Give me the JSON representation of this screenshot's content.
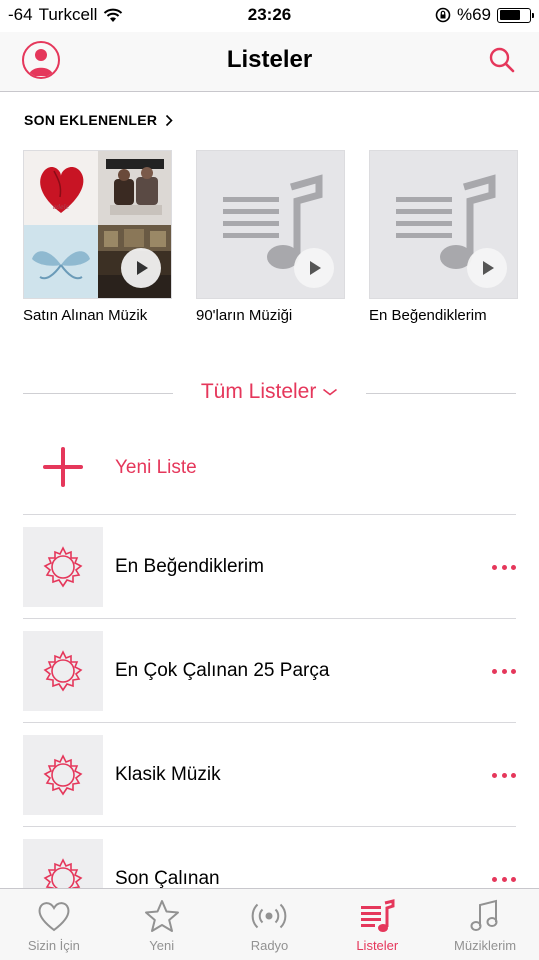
{
  "status_bar": {
    "signal": "-64",
    "carrier": "Turkcell",
    "time": "23:26",
    "battery": "%69",
    "battery_level": 0.69
  },
  "nav": {
    "title": "Listeler"
  },
  "recently_added": {
    "header": "SON EKLENENLER",
    "items": [
      {
        "label": "Satın Alınan Müzik"
      },
      {
        "label": "90'ların Müziği"
      },
      {
        "label": "En Beğendiklerim"
      }
    ]
  },
  "all_playlists": {
    "label": "Tüm Listeler"
  },
  "new_playlist": {
    "label": "Yeni Liste"
  },
  "playlists": [
    {
      "label": "En Beğendiklerim"
    },
    {
      "label": "En Çok Çalınan 25 Parça"
    },
    {
      "label": "Klasik Müzik"
    },
    {
      "label": "Son Çalınan"
    }
  ],
  "tabs": [
    {
      "label": "Sizin İçin",
      "icon": "heart-icon"
    },
    {
      "label": "Yeni",
      "icon": "star-icon"
    },
    {
      "label": "Radyo",
      "icon": "radio-icon"
    },
    {
      "label": "Listeler",
      "icon": "playlist-icon",
      "active": true
    },
    {
      "label": "Müziklerim",
      "icon": "music-note-icon"
    }
  ],
  "colors": {
    "accent": "#e5375b",
    "inactive": "#929292"
  }
}
